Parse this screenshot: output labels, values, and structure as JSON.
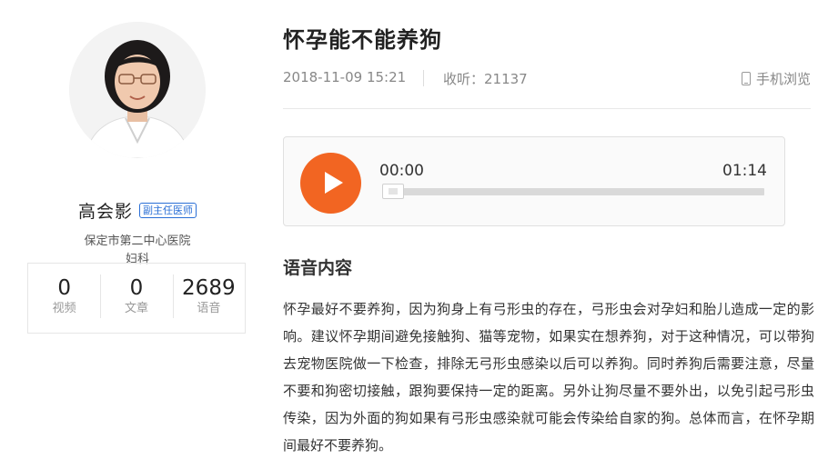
{
  "doctor": {
    "name": "高会影",
    "title_badge": "副主任医师",
    "hospital": "保定市第二中心医院",
    "department": "妇科",
    "stats": [
      {
        "value": "0",
        "label": "视频"
      },
      {
        "value": "0",
        "label": "文章"
      },
      {
        "value": "2689",
        "label": "语音"
      }
    ]
  },
  "article": {
    "title": "怀孕能不能养狗",
    "date": "2018-11-09 15:21",
    "listens": "收听：21137",
    "mobile_view": "手机浏览"
  },
  "player": {
    "current_time": "00:00",
    "total_time": "01:14",
    "progress": 0
  },
  "content": {
    "heading": "语音内容",
    "body": "怀孕最好不要养狗，因为狗身上有弓形虫的存在，弓形虫会对孕妇和胎儿造成一定的影响。建议怀孕期间避免接触狗、猫等宠物，如果实在想养狗，对于这种情况，可以带狗去宠物医院做一下检查，排除无弓形虫感染以后可以养狗。同时养狗后需要注意，尽量不要和狗密切接触，跟狗要保持一定的距离。另外让狗尽量不要外出，以免引起弓形虫传染，因为外面的狗如果有弓形虫感染就可能会传染给自家的狗。总体而言，在怀孕期间最好不要养狗。"
  },
  "colors": {
    "accent": "#f26522",
    "badge": "#2a6fd6"
  },
  "icons": [
    "phone-icon",
    "play-icon"
  ]
}
